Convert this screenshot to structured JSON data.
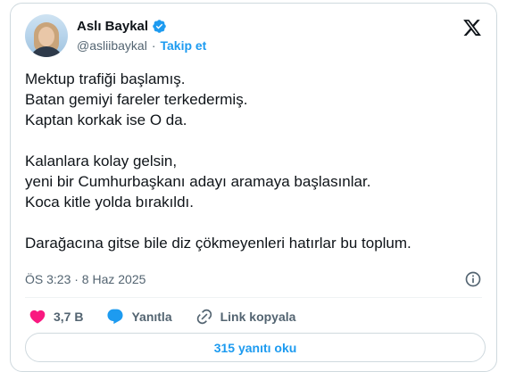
{
  "author": {
    "display_name": "Aslı Baykal",
    "handle": "@asliibaykal",
    "separator": "·",
    "follow_label": "Takip et",
    "verified_color": "#1d9bf0"
  },
  "tweet": {
    "paragraphs": [
      [
        "Mektup trafiği başlamış.",
        "Batan gemiyi fareler terkedermiş.",
        "Kaptan korkak ise O da."
      ],
      [
        "Kalanlara kolay gelsin,",
        "yeni bir Cumhurbaşkanı adayı aramaya başlasınlar.",
        "Koca kitle yolda bırakıldı."
      ],
      [
        "Darağacına gitse bile diz çökmeyenleri hatırlar bu toplum."
      ]
    ],
    "timestamp": "ÖS 3:23 · 8 Haz 2025"
  },
  "actions": {
    "like_count": "3,7 B",
    "reply_label": "Yanıtla",
    "copy_link_label": "Link kopyala",
    "like_color": "#f91880",
    "reply_color": "#1d9bf0"
  },
  "replies_button": {
    "label": "315 yanıtı oku"
  },
  "icons": {
    "logo": "x-logo-icon",
    "verified": "verified-badge-icon",
    "info": "info-icon",
    "like": "heart-icon",
    "reply": "reply-bubble-icon",
    "link": "link-icon"
  }
}
